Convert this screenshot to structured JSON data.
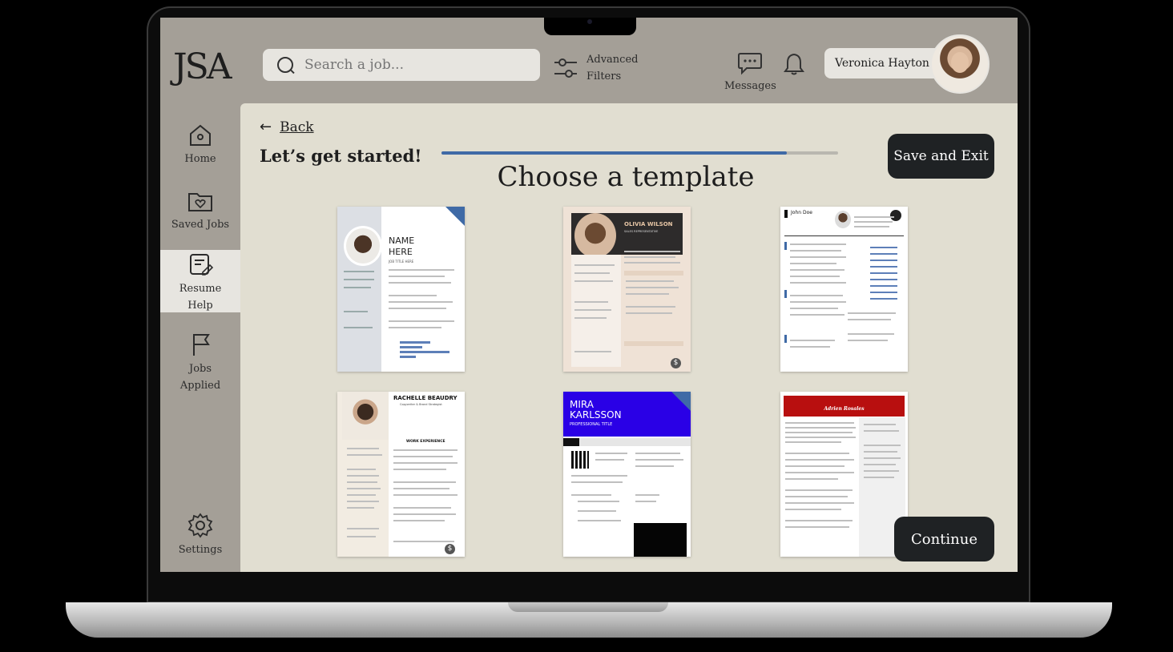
{
  "app": {
    "logo": "JSA"
  },
  "search": {
    "placeholder": "Search a job..."
  },
  "filters": {
    "line1": "Advanced",
    "line2": "Filters"
  },
  "messages": {
    "label": "Messages"
  },
  "user": {
    "name": "Veronica Hayton"
  },
  "sidebar": {
    "items": [
      {
        "label": "Home"
      },
      {
        "label": "Saved Jobs"
      },
      {
        "label_line1": "Resume",
        "label_line2": "Help"
      },
      {
        "label_line1": "Jobs",
        "label_line2": "Applied"
      },
      {
        "label": "Settings"
      }
    ]
  },
  "main": {
    "back": "Back",
    "started": "Let’s get started!",
    "progress": 0.87,
    "save_exit": "Save and Exit",
    "heading": "Choose a template",
    "continue": "Continue",
    "templates": [
      {
        "name_l1": "NAME",
        "name_l2": "HERE",
        "sub": "JOB TITLE HERE",
        "tier": "premium"
      },
      {
        "name": "OLIVIA WILSON",
        "sub": "SALES REPRESENTATIVE",
        "tier": "paid"
      },
      {
        "name": "John Doe",
        "tier": "free"
      },
      {
        "name": "RACHELLE BEAUDRY",
        "sub": "Copywriter & Brand Strategist",
        "section": "WORK EXPERIENCE",
        "tier": "paid"
      },
      {
        "name_l1": "MIRA",
        "name_l2": "KARLSSON",
        "sub": "PROFESSIONAL TITLE",
        "tier": "premium"
      },
      {
        "name": "Adrien Rosales",
        "tier": "free"
      }
    ]
  },
  "colors": {
    "accent": "#3f6aa6",
    "dark_button": "#1f2224",
    "panel": "#e1ded1",
    "chrome": "#a49f97"
  }
}
